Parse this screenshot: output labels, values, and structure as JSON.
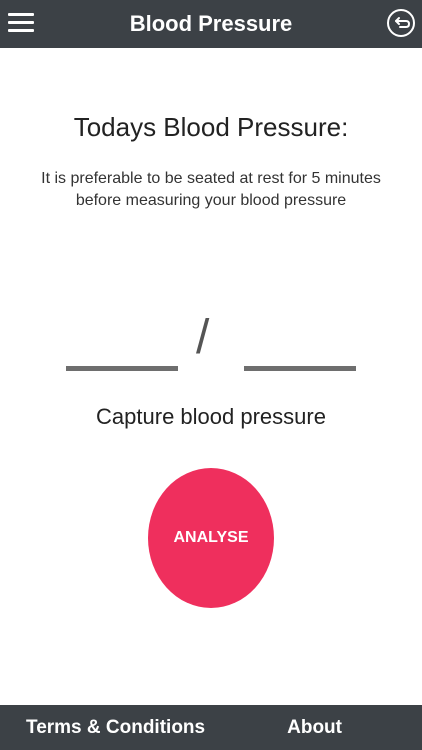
{
  "header": {
    "title": "Blood Pressure",
    "menu_icon": "hamburger-menu-icon",
    "back_icon": "back-arrow-circle-icon",
    "background_color": "#3c4146"
  },
  "main": {
    "title": "Todays Blood Pressure:",
    "instructions": "It is preferable to be seated at rest for 5 minutes before measuring your blood pressure",
    "separator": "/",
    "systolic_value": "",
    "diastolic_value": "",
    "capture_label": "Capture blood pressure",
    "analyse_label": "ANALYSE",
    "analyse_color": "#ef2f5d"
  },
  "footer": {
    "terms_label": "Terms & Conditions",
    "about_label": "About"
  }
}
